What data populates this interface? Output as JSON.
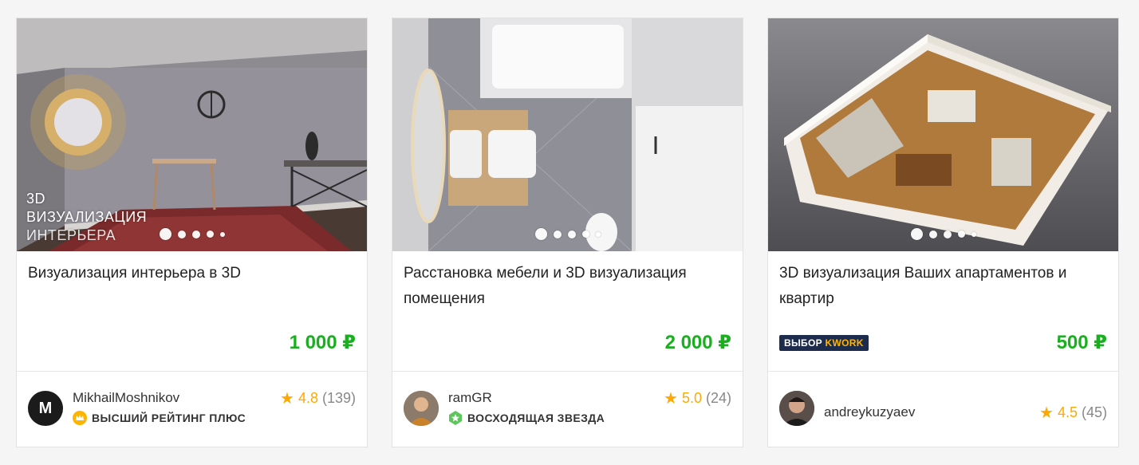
{
  "cards": [
    {
      "overlay_lines": [
        "3D",
        "ВИЗУАЛИЗАЦИЯ",
        "ИНТЕРЬЕРА"
      ],
      "title": "Визуализация интерьера в 3D",
      "price": "1 000 ₽",
      "seller": {
        "name": "MikhailMoshnikov",
        "avatar_letter": "M",
        "level": "ВЫСШИЙ РЕЙТИНГ ПЛЮС",
        "level_icon": "crown-icon",
        "level_color": "#ffb400"
      },
      "rating": {
        "score": "4.8",
        "count": "(139)"
      }
    },
    {
      "title": "Расстановка мебели и 3D визуализация помещения",
      "price": "2 000 ₽",
      "seller": {
        "name": "ramGR",
        "level": "ВОСХОДЯЩАЯ ЗВЕЗДА",
        "level_icon": "star-badge-icon",
        "level_color": "#5cc65c"
      },
      "rating": {
        "score": "5.0",
        "count": "(24)"
      }
    },
    {
      "title": "3D визуализация Ваших апартаментов и квартир",
      "price": "500 ₽",
      "badge": {
        "text": "ВЫБОР",
        "accent": "KWORK"
      },
      "seller": {
        "name": "andreykuzyaev"
      },
      "rating": {
        "score": "4.5",
        "count": "(45)"
      }
    }
  ],
  "colors": {
    "price": "#1aaf1f",
    "star": "#ffa800",
    "badge_bg": "#1d2c4d",
    "badge_accent": "#ffb400"
  }
}
